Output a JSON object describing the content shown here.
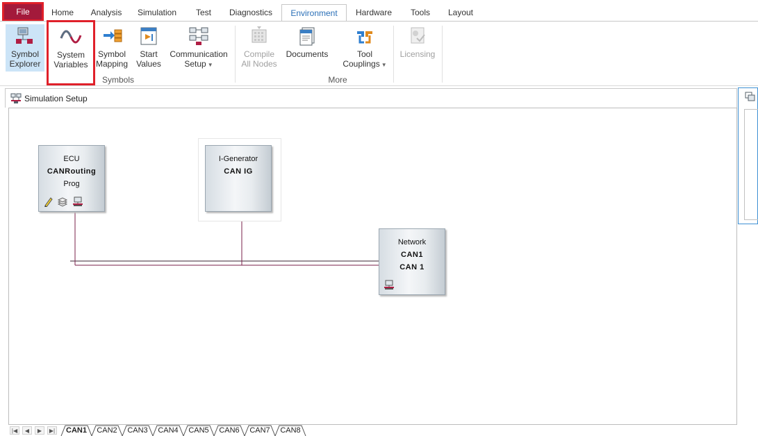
{
  "ribbon": {
    "tabs": [
      {
        "label": "File"
      },
      {
        "label": "Home"
      },
      {
        "label": "Analysis"
      },
      {
        "label": "Simulation"
      },
      {
        "label": "Test"
      },
      {
        "label": "Diagnostics"
      },
      {
        "label": "Environment"
      },
      {
        "label": "Hardware"
      },
      {
        "label": "Tools"
      },
      {
        "label": "Layout"
      }
    ],
    "active_tab": "Environment",
    "buttons": {
      "symbol_explorer": {
        "line1": "Symbol",
        "line2": "Explorer",
        "icon": "symbol-explorer-icon"
      },
      "system_variables": {
        "line1": "System",
        "line2": "Variables",
        "icon": "sine-wave-icon"
      },
      "symbol_mapping": {
        "line1": "Symbol",
        "line2": "Mapping",
        "icon": "mapping-arrow-icon"
      },
      "start_values": {
        "line1": "Start",
        "line2": "Values",
        "icon": "start-values-icon"
      },
      "communication_setup": {
        "line1": "Communication",
        "line2": "Setup",
        "icon": "network-nodes-icon"
      },
      "compile_all_nodes": {
        "line1": "Compile",
        "line2": "All Nodes",
        "icon": "compile-icon",
        "disabled": true
      },
      "documents": {
        "line1": "Documents",
        "line2": "",
        "icon": "document-icon"
      },
      "tool_couplings": {
        "line1": "Tool",
        "line2": "Couplings",
        "icon": "coupling-icon"
      },
      "licensing": {
        "line1": "Licensing",
        "line2": "",
        "icon": "license-icon",
        "disabled": true
      }
    },
    "groups": {
      "symbols": "Symbols",
      "more": "More"
    }
  },
  "window": {
    "title": "Simulation Setup"
  },
  "blocks": {
    "ecu": {
      "type": "ECU",
      "name": "CANRouting",
      "sub": "Prog"
    },
    "igen": {
      "type": "I-Generator",
      "name": "CAN IG"
    },
    "network": {
      "type": "Network",
      "name": "CAN1",
      "sub": "CAN 1"
    }
  },
  "sheet_tabs": [
    "CAN1",
    "CAN2",
    "CAN3",
    "CAN4",
    "CAN5",
    "CAN6",
    "CAN7",
    "CAN8"
  ],
  "active_sheet": "CAN1",
  "colors": {
    "file_tab": "#a31a3b",
    "highlight": "#e0202a",
    "active_tab_text": "#2a6fb7",
    "bus_line": "#7a1f4a"
  }
}
